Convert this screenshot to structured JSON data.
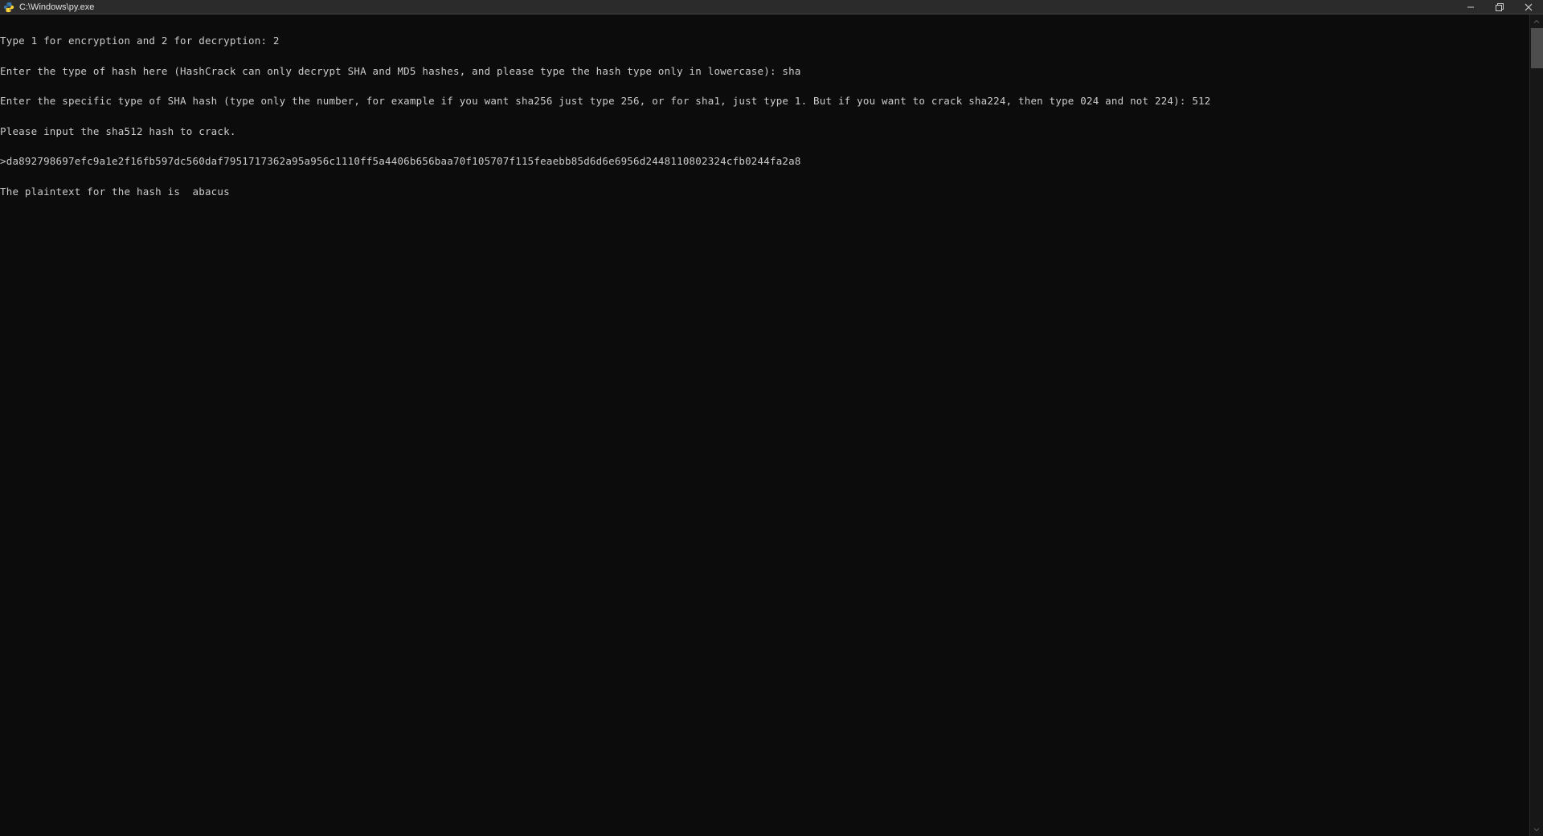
{
  "titlebar": {
    "title": "C:\\Windows\\py.exe"
  },
  "terminal": {
    "lines": [
      "Type 1 for encryption and 2 for decryption: 2",
      "Enter the type of hash here (HashCrack can only decrypt SHA and MD5 hashes, and please type the hash type only in lowercase): sha",
      "Enter the specific type of SHA hash (type only the number, for example if you want sha256 just type 256, or for sha1, just type 1. But if you want to crack sha224, then type 024 and not 224): 512",
      "Please input the sha512 hash to crack.",
      ">da892798697efc9a1e2f16fb597dc560daf7951717362a95a956c1110ff5a4406b656baa70f105707f115feaebb85d6d6e6956d2448110802324cfb0244fa2a8",
      "The plaintext for the hash is  abacus"
    ]
  }
}
